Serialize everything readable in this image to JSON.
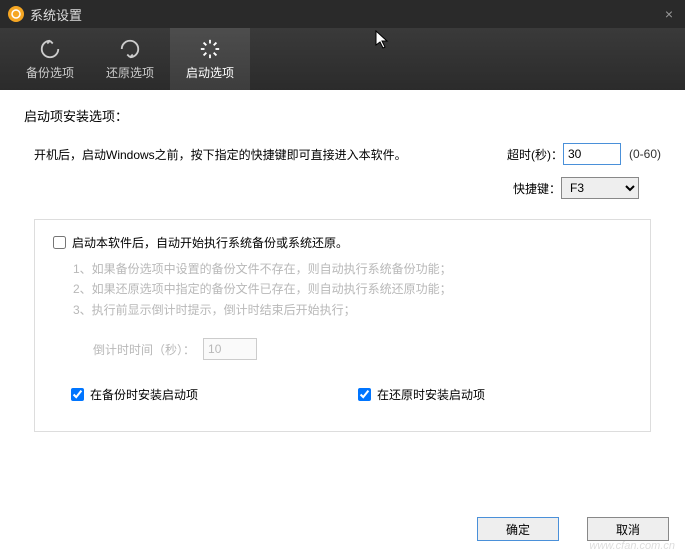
{
  "titlebar": {
    "title": "系统设置",
    "close": "×"
  },
  "tabs": {
    "backup": "备份选项",
    "restore": "还原选项",
    "startup": "启动选项"
  },
  "section_title": "启动项安装选项：",
  "main_desc": "开机后，启动Windows之前，按下指定的快捷键即可直接进入本软件。",
  "timeout": {
    "label": "超时(秒)：",
    "value": "30",
    "range": "(0-60)"
  },
  "hotkey": {
    "label": "快捷键：",
    "value": "F3"
  },
  "auto_run_label": "启动本软件后，自动开始执行系统备份或系统还原。",
  "hints": {
    "l1": "1、如果备份选项中设置的备份文件不存在，则自动执行系统备份功能；",
    "l2": "2、如果还原选项中指定的备份文件已存在，则自动执行系统还原功能；",
    "l3": "3、执行前显示倒计时提示，倒计时结束后开始执行；"
  },
  "countdown": {
    "label": "倒计时时间（秒）：",
    "value": "10"
  },
  "chk_backup_install": "在备份时安装启动项",
  "chk_restore_install": "在还原时安装启动项",
  "buttons": {
    "ok": "确定",
    "cancel": "取消"
  },
  "watermark": "www.cfan.com.cn"
}
